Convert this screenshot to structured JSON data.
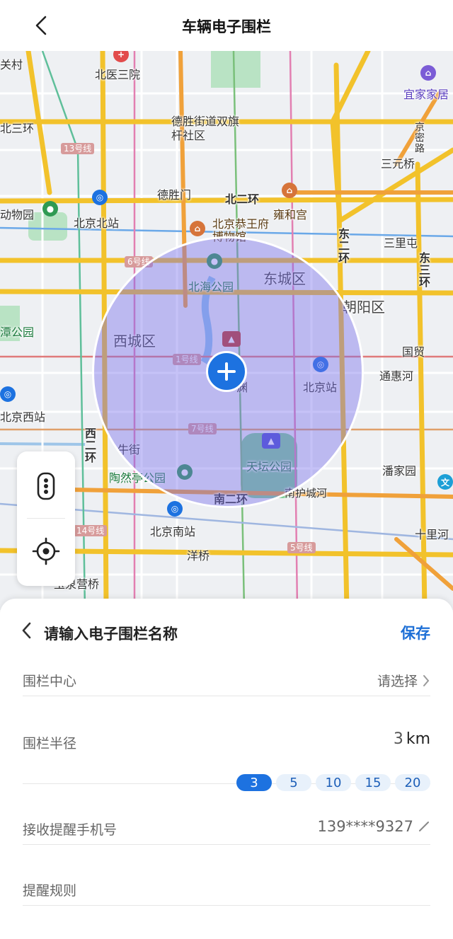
{
  "header": {
    "title": "车辆电子围栏"
  },
  "map": {
    "labels": {
      "village": "关村",
      "hosp3": "北医三院",
      "yijia": "宜家家居",
      "desheng_sub": "德胜街道双旗杆社区",
      "north3ring": "北三环",
      "sanyuanqiao": "三元桥",
      "dongwuyuan": "动物园",
      "beijingbeizhan": "北京北站",
      "deshengmen": "德胜门",
      "north2ring": "北二环",
      "yonghegong": "雍和宫",
      "gongwangfu": "北京恭王府博物馆",
      "sanlitun": "三里屯",
      "beihai": "北海公园",
      "dongcheng": "东城区",
      "chaoyang": "朝阳区",
      "xicheng": "西城区",
      "guomao": "国贸",
      "tonghuihe": "通惠河",
      "beijingzhan": "北京站",
      "xizhan": "北京西站",
      "niujie": "牛街",
      "tiantan": "天坛公园",
      "panjiayuan": "潘家园",
      "taoranting": "陶然亭公园",
      "south2ring": "南二环",
      "nanhucheng": "南护城河",
      "beijingnan": "北京南站",
      "yangqiao": "洋桥",
      "shilihe": "十里河",
      "yuquanying": "玉泉营桥",
      "east2ring": "东二环",
      "east3ring": "东三环",
      "west2ring": "西二环",
      "yuantuan": "渊",
      "jingjiao": "京密路",
      "park_left": "潭公园"
    },
    "road_tags": {
      "l13": "13号线",
      "l6": "6号线",
      "l1": "1号线",
      "l7": "7号线",
      "l14": "14号线",
      "l5": "5号线"
    }
  },
  "panel": {
    "title": "请输入电子围栏名称",
    "save": "保存",
    "center": {
      "label": "围栏中心",
      "value": "请选择"
    },
    "radius": {
      "label": "围栏半径",
      "value": "3",
      "unit": "km",
      "options": [
        "3",
        "5",
        "10",
        "15",
        "20"
      ],
      "selected": "3"
    },
    "phone": {
      "label": "接收提醒手机号",
      "value": "139****9327"
    },
    "rules": {
      "label": "提醒规则"
    }
  },
  "colors": {
    "accent": "#1d72e0",
    "fence": "#786eeb",
    "save": "#1d6fd6"
  }
}
